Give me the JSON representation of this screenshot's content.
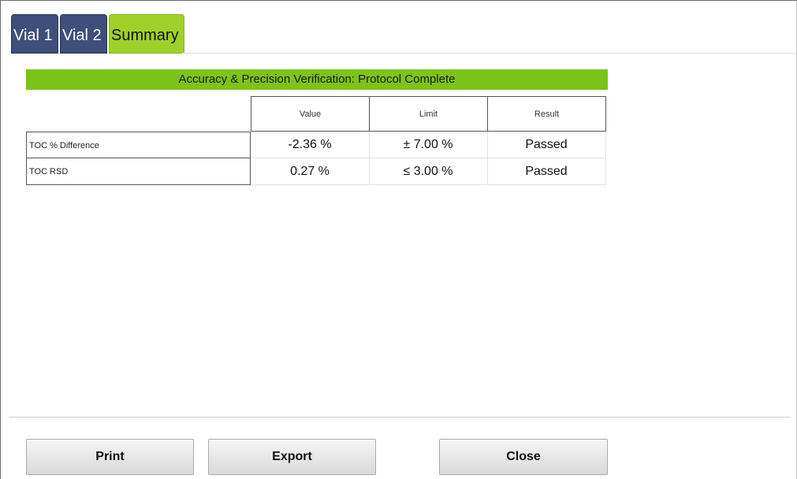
{
  "tabs": [
    {
      "label": "Vial 1",
      "active": false
    },
    {
      "label": "Vial 2",
      "active": false
    },
    {
      "label": "Summary",
      "active": true
    }
  ],
  "banner": "Accuracy & Precision Verification: Protocol Complete",
  "table": {
    "columns": [
      "Value",
      "Limit",
      "Result"
    ],
    "rows": [
      {
        "label": "TOC % Difference",
        "value": "-2.36 %",
        "limit": "± 7.00 %",
        "result": "Passed"
      },
      {
        "label": "TOC RSD",
        "value": "0.27 %",
        "limit": "≤ 3.00 %",
        "result": "Passed"
      }
    ]
  },
  "buttons": {
    "print": "Print",
    "export": "Export",
    "close": "Close"
  },
  "colors": {
    "tab_inactive": "#3d4f7a",
    "tab_active": "#9fd02a",
    "banner": "#7ec319"
  }
}
